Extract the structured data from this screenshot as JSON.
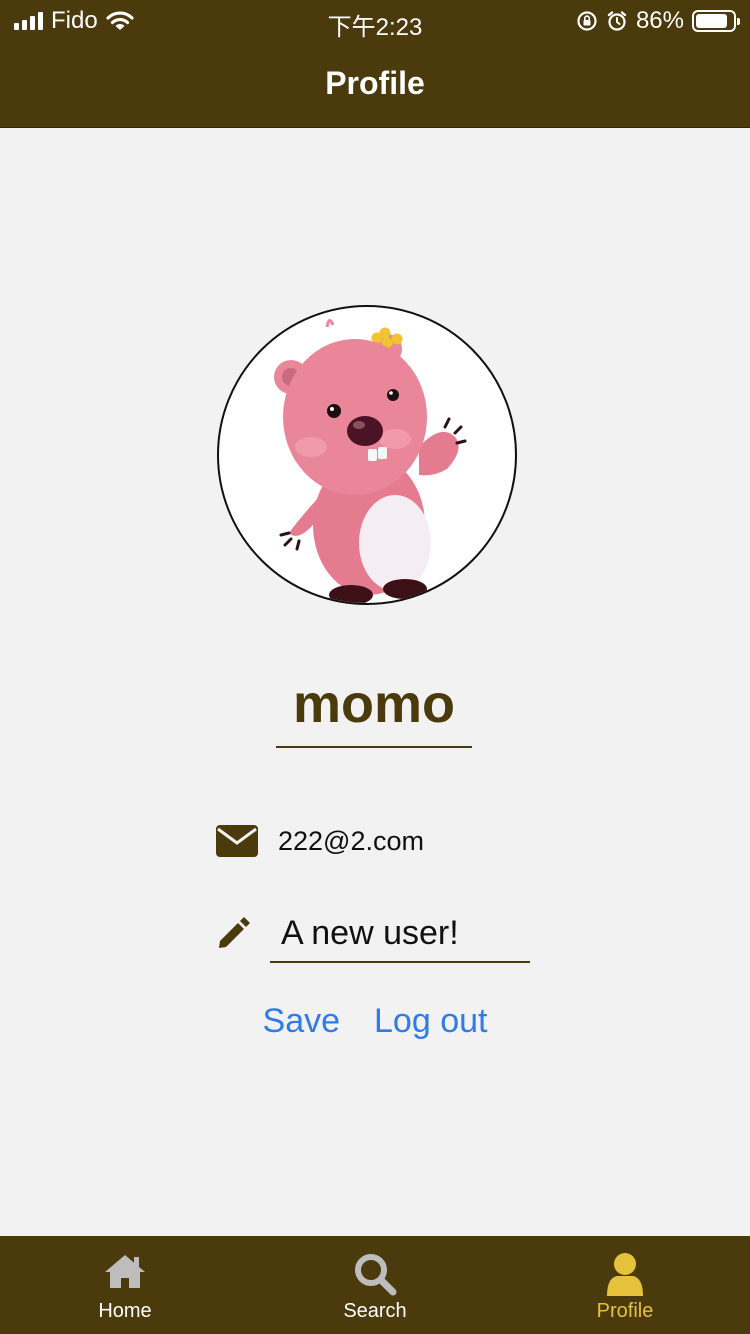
{
  "status_bar": {
    "carrier": "Fido",
    "time": "下午2:23",
    "battery": "86%",
    "battery_level": 0.86
  },
  "header": {
    "title": "Profile"
  },
  "profile": {
    "username": "momo",
    "email": "222@2.com",
    "bio_value": "A new user!",
    "avatar_icon": "pink-beaver-character"
  },
  "actions": {
    "save_label": "Save",
    "logout_label": "Log out"
  },
  "tab_bar": {
    "tabs": [
      {
        "label": "Home",
        "icon": "home-icon"
      },
      {
        "label": "Search",
        "icon": "search-icon"
      },
      {
        "label": "Profile",
        "icon": "person-icon"
      }
    ],
    "active": "Profile"
  },
  "colors": {
    "brand": "#4a3a0c",
    "active_tab": "#e6c23a",
    "link": "#2f7be8",
    "background": "#f2f2f2"
  }
}
